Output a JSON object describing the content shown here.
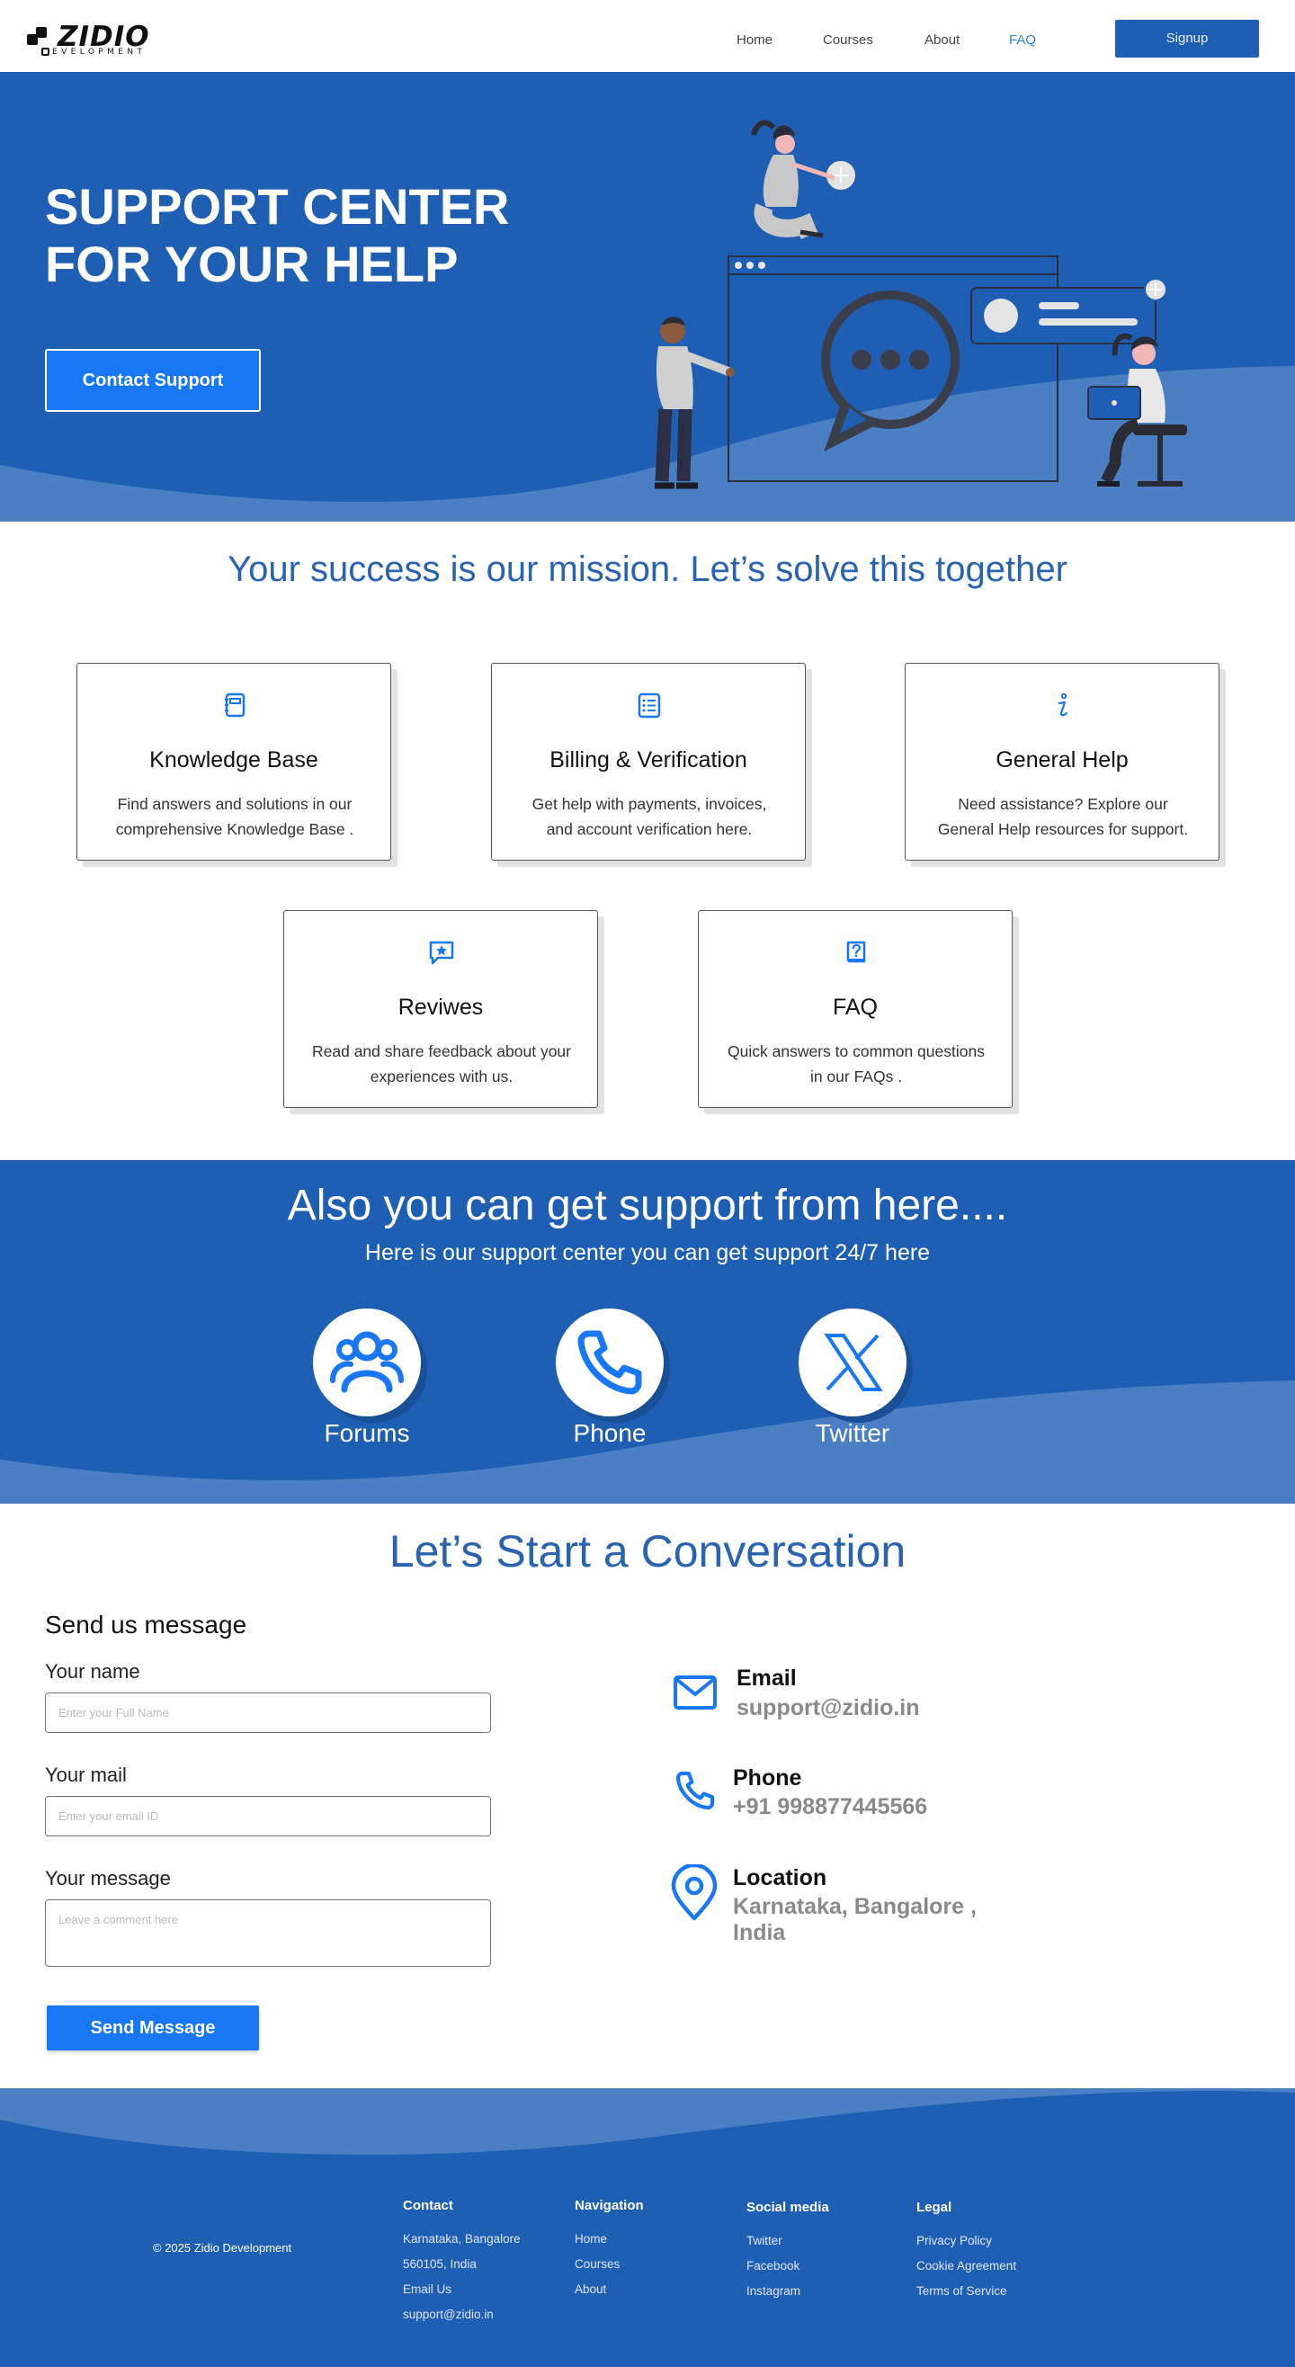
{
  "brand": {
    "name": "ZIDIO",
    "sub": "EVELOPMENT"
  },
  "nav": {
    "items": [
      "Home",
      "Courses",
      "About",
      "FAQ"
    ],
    "active": "FAQ",
    "signup": "Signup"
  },
  "hero": {
    "title_line1": "SUPPORT CENTER",
    "title_line2": "FOR YOUR HELP",
    "cta": "Contact Support"
  },
  "mission": {
    "heading": "Your success is our mission. Let’s solve this together"
  },
  "cards": [
    {
      "icon": "notebook-icon",
      "title": "Knowledge Base",
      "desc": "Find answers and solutions in our comprehensive Knowledge Base ."
    },
    {
      "icon": "receipt-list-icon",
      "title": "Billing & Verification",
      "desc": "Get help with payments, invoices, and account verification here."
    },
    {
      "icon": "info-icon",
      "title": "General Help",
      "desc": "Need assistance? Explore our General Help resources for support."
    },
    {
      "icon": "star-message-icon",
      "title": "Reviwes",
      "desc": "Read and share feedback about your experiences with us."
    },
    {
      "icon": "question-book-icon",
      "title": "FAQ",
      "desc": "Quick answers to common questions in our FAQs ."
    }
  ],
  "support": {
    "heading": "Also you can get support from here....",
    "sub": "Here is our support center you can get support 24/7 here",
    "channels": [
      {
        "icon": "users-icon",
        "label": "Forums"
      },
      {
        "icon": "phone-icon",
        "label": "Phone"
      },
      {
        "icon": "x-logo-icon",
        "label": "Twitter"
      }
    ]
  },
  "conversation": {
    "heading": "Let’s Start a Conversation",
    "form_title": "Send us message",
    "name_label": "Your name",
    "name_placeholder": "Enter your Full Name",
    "mail_label": "Your mail",
    "mail_placeholder": "Enter your email ID",
    "message_label": "Your message",
    "message_placeholder": "Leave a comment here",
    "send": "Send Message"
  },
  "contact_info": {
    "email_label": "Email",
    "email_value": "support@zidio.in",
    "phone_label": "Phone",
    "phone_value": "+91 998877445566",
    "location_label": "Location",
    "location_line1": "Karnataka, Bangalore ,",
    "location_line2": "India"
  },
  "footer": {
    "copyright": "© 2025 Zidio Development",
    "contact_title": "Contact",
    "contact_lines": [
      "Karnataka, Bangalore",
      "560105, India",
      "Email Us",
      "support@zidio.in"
    ],
    "nav_title": "Navigation",
    "nav_links": [
      "Home",
      "Courses",
      "About"
    ],
    "social_title": "Social media",
    "social_links": [
      "Twitter",
      "Facebook",
      "Instagram"
    ],
    "legal_title": "Legal",
    "legal_links": [
      "Privacy Policy",
      "Cookie Agreement",
      "Terms of Service"
    ]
  },
  "colors": {
    "primary": "#1e5fb3",
    "accent": "#1877f2",
    "heading_blue": "#2a63b0",
    "wave_light": "#4a7fc4"
  }
}
